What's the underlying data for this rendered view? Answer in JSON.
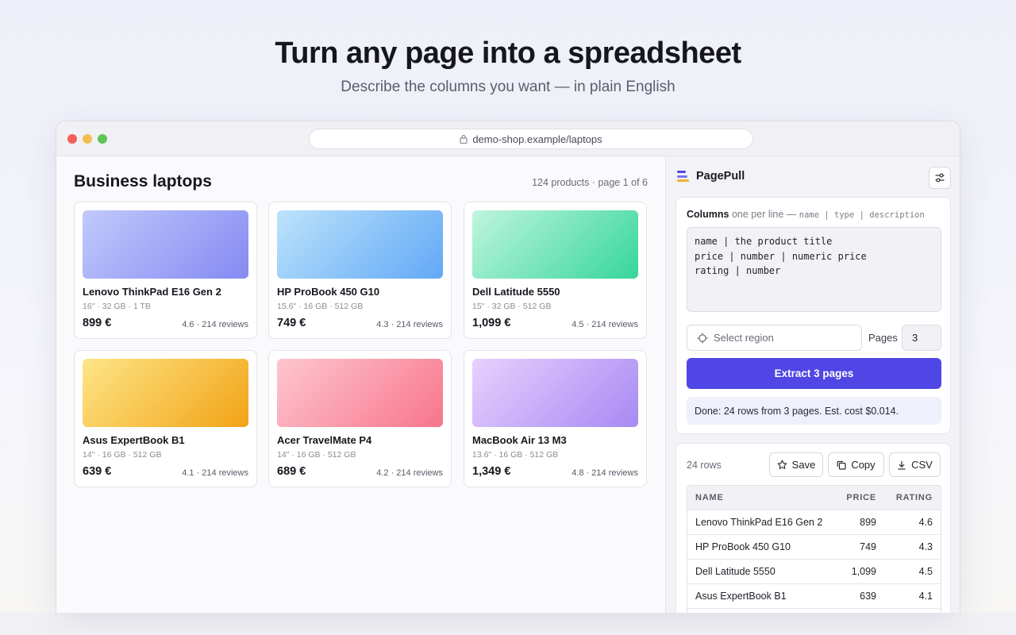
{
  "hero": {
    "title": "Turn any page into a spreadsheet",
    "subtitle": "Describe the columns you want — in plain English"
  },
  "browser": {
    "url": "demo-shop.example/laptops"
  },
  "shop": {
    "title": "Business laptops",
    "count": "124 products · page 1 of 6",
    "products": [
      {
        "name": "Lenovo ThinkPad E16 Gen 2",
        "spec": "16\" · 32 GB · 1 TB",
        "price": "899 €",
        "rating": "4.6 · 214 reviews",
        "gradient": [
          "#c1c9fb",
          "#858af2"
        ]
      },
      {
        "name": "HP ProBook 450 G10",
        "spec": "15.6\" · 16 GB · 512 GB",
        "price": "749 €",
        "rating": "4.3 · 214 reviews",
        "gradient": [
          "#bce3fa",
          "#62a8f7"
        ]
      },
      {
        "name": "Dell Latitude 5550",
        "spec": "15\" · 32 GB · 512 GB",
        "price": "1,099 €",
        "rating": "4.5 · 214 reviews",
        "gradient": [
          "#bff5de",
          "#36d69b"
        ]
      },
      {
        "name": "Asus ExpertBook B1",
        "spec": "14\" · 16 GB · 512 GB",
        "price": "639 €",
        "rating": "4.1 · 214 reviews",
        "gradient": [
          "#fde587",
          "#f2a316"
        ]
      },
      {
        "name": "Acer TravelMate P4",
        "spec": "14\" · 16 GB · 512 GB",
        "price": "689 €",
        "rating": "4.2 · 214 reviews",
        "gradient": [
          "#fdc6cf",
          "#f8758b"
        ]
      },
      {
        "name": "MacBook Air 13 M3",
        "spec": "13.6\" · 16 GB · 512 GB",
        "price": "1,349 €",
        "rating": "4.8 · 214 reviews",
        "gradient": [
          "#e6d1fd",
          "#a889f4"
        ]
      }
    ]
  },
  "panel": {
    "brand": "PagePull",
    "columns_label": "Columns",
    "columns_hint": "one per line —",
    "columns_format": "name | type | description",
    "columns_value": "name | the product title\nprice | number | numeric price\nrating | number",
    "region_label": "Select region",
    "pages_label": "Pages",
    "pages_value": "3",
    "extract_label": "Extract 3 pages",
    "status": "Done: 24 rows from 3 pages. Est. cost $0.014.",
    "accent": "#4f46e5"
  },
  "results": {
    "rows_count": "24 rows",
    "save_label": "Save",
    "copy_label": "Copy",
    "csv_label": "CSV",
    "headers": [
      "NAME",
      "PRICE",
      "RATING"
    ],
    "rows": [
      [
        "Lenovo ThinkPad E16 Gen 2",
        "899",
        "4.6"
      ],
      [
        "HP ProBook 450 G10",
        "749",
        "4.3"
      ],
      [
        "Dell Latitude 5550",
        "1,099",
        "4.5"
      ],
      [
        "Asus ExpertBook B1",
        "639",
        "4.1"
      ]
    ]
  }
}
